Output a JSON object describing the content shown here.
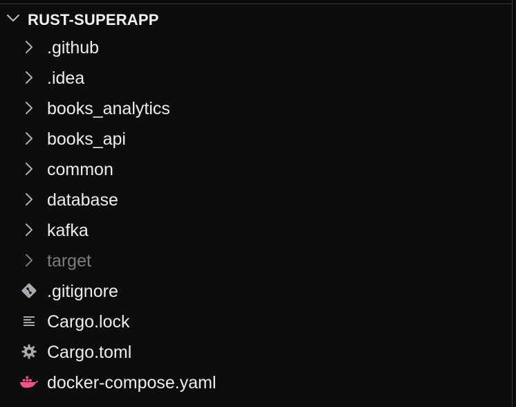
{
  "explorer": {
    "root": {
      "label": "RUST-SUPERAPP",
      "icon": "chevron-down-icon"
    },
    "items": [
      {
        "label": ".github",
        "icon": "chevron-right-icon",
        "kind": "folder",
        "dimmed": false
      },
      {
        "label": ".idea",
        "icon": "chevron-right-icon",
        "kind": "folder",
        "dimmed": false
      },
      {
        "label": "books_analytics",
        "icon": "chevron-right-icon",
        "kind": "folder",
        "dimmed": false
      },
      {
        "label": "books_api",
        "icon": "chevron-right-icon",
        "kind": "folder",
        "dimmed": false
      },
      {
        "label": "common",
        "icon": "chevron-right-icon",
        "kind": "folder",
        "dimmed": false
      },
      {
        "label": "database",
        "icon": "chevron-right-icon",
        "kind": "folder",
        "dimmed": false
      },
      {
        "label": "kafka",
        "icon": "chevron-right-icon",
        "kind": "folder",
        "dimmed": false
      },
      {
        "label": "target",
        "icon": "chevron-right-icon",
        "kind": "folder",
        "dimmed": true
      },
      {
        "label": ".gitignore",
        "icon": "git-icon",
        "kind": "file",
        "dimmed": false
      },
      {
        "label": "Cargo.lock",
        "icon": "lines-icon",
        "kind": "file",
        "dimmed": false
      },
      {
        "label": "Cargo.toml",
        "icon": "gear-icon",
        "kind": "file",
        "dimmed": false
      },
      {
        "label": "docker-compose.yaml",
        "icon": "docker-icon",
        "kind": "file",
        "dimmed": false
      }
    ]
  },
  "colors": {
    "background": "#0d0d0e",
    "text": "#ededed",
    "dimmed_text": "#7d7d80",
    "icon": "#a9a9ad",
    "docker_icon": "#e8598a"
  }
}
